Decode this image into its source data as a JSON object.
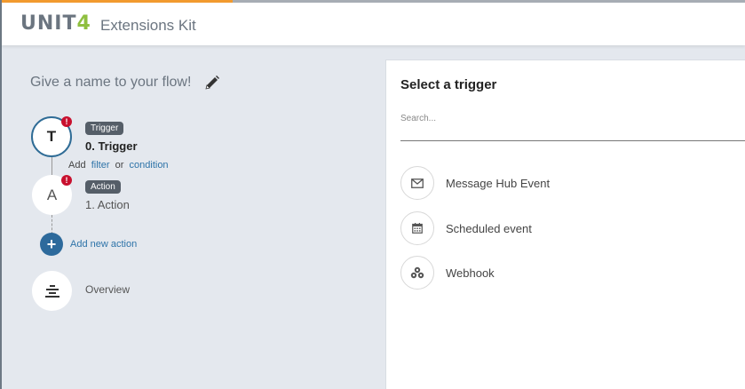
{
  "header": {
    "logo_text": "UNIT",
    "logo_digit": "4",
    "app_name": "Extensions Kit"
  },
  "flow": {
    "name_placeholder": "Give a name to your flow!",
    "trigger": {
      "letter": "T",
      "tag": "Trigger",
      "title": "0. Trigger",
      "error": "!",
      "add_label": "Add",
      "filter_link": "filter",
      "or_text": "or",
      "condition_link": "condition"
    },
    "action": {
      "letter": "A",
      "tag": "Action",
      "title": "1. Action",
      "error": "!"
    },
    "add_action": {
      "icon": "+",
      "label": "Add new action"
    },
    "overview": {
      "label": "Overview"
    }
  },
  "panel": {
    "title": "Select a trigger",
    "search_placeholder": "Search...",
    "options": [
      {
        "label": "Message Hub Event",
        "icon": "envelope-icon"
      },
      {
        "label": "Scheduled event",
        "icon": "calendar-icon"
      },
      {
        "label": "Webhook",
        "icon": "webhook-icon"
      }
    ]
  },
  "colors": {
    "accent_blue": "#2d6a9c",
    "error_red": "#c8102e",
    "logo_green": "#8fbf3f",
    "top_orange": "#f29a2e"
  }
}
